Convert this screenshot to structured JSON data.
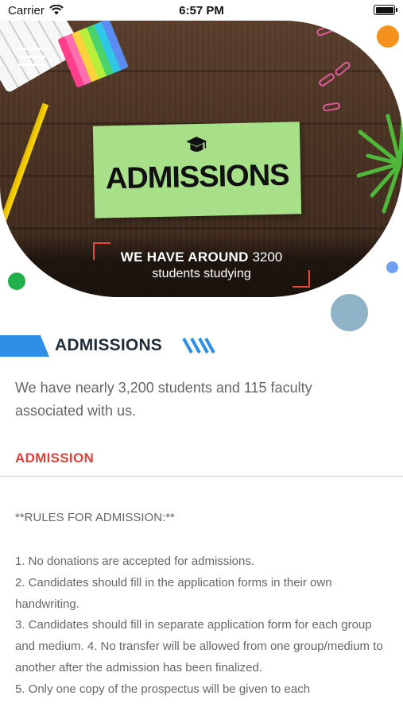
{
  "status_bar": {
    "carrier": "Carrier",
    "time": "6:57 PM"
  },
  "hero": {
    "card_title": "ADMISSIONS",
    "stat_bold": "WE HAVE AROUND",
    "stat_number": "3200",
    "stat_suffix": "students studying"
  },
  "section": {
    "title": "ADMISSIONS"
  },
  "intro": "We have nearly 3,200 students and 115 faculty associated with us.",
  "admission": {
    "heading": "ADMISSION",
    "rules_title": "**RULES FOR ADMISSION:**",
    "rules_text": "1. No donations are accepted for admissions.\n2. Candidates should fill in the application forms in their own handwriting.\n3. Candidates should fill in separate application form for each group and medium. 4. No transfer will be allowed from one group/medium to another after the admission has been finalized.\n5. Only one copy of the prospectus will be given to each"
  },
  "colors": {
    "accent_blue": "#2f8fe6",
    "accent_red": "#e0413a",
    "dot_orange": "#f5921e",
    "dot_green": "#22b04b",
    "dot_blue": "#6f9ff0",
    "dot_steel": "#8fb4c8"
  },
  "icons": [
    "wifi-icon",
    "battery-icon",
    "menu-icon",
    "graduation-cap-icon",
    "triple-slash-icon"
  ]
}
